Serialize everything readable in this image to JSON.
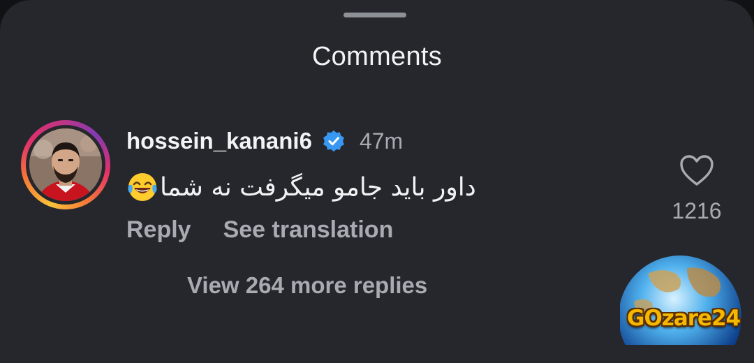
{
  "sheet": {
    "title": "Comments",
    "handle_label": "drag-handle"
  },
  "comment": {
    "username": "hossein_kanani6",
    "verified": true,
    "time": "47m",
    "text": "داور باید جامو میگرفت نه شما",
    "emoji": "face-with-tears-of-joy",
    "reply_label": "Reply",
    "translate_label": "See translation",
    "more_replies_label": "View 264 more replies",
    "like_count": "1216"
  },
  "watermark": {
    "text": "GOzare24"
  },
  "colors": {
    "sheet_bg": "#25272c",
    "text_primary": "#f2f3f5",
    "text_secondary": "#a8abb2",
    "verified_blue": "#3897f0"
  },
  "icons": [
    "drag-handle",
    "verified-badge-icon",
    "laughing-emoji-icon",
    "heart-outline-icon",
    "globe-logo"
  ]
}
